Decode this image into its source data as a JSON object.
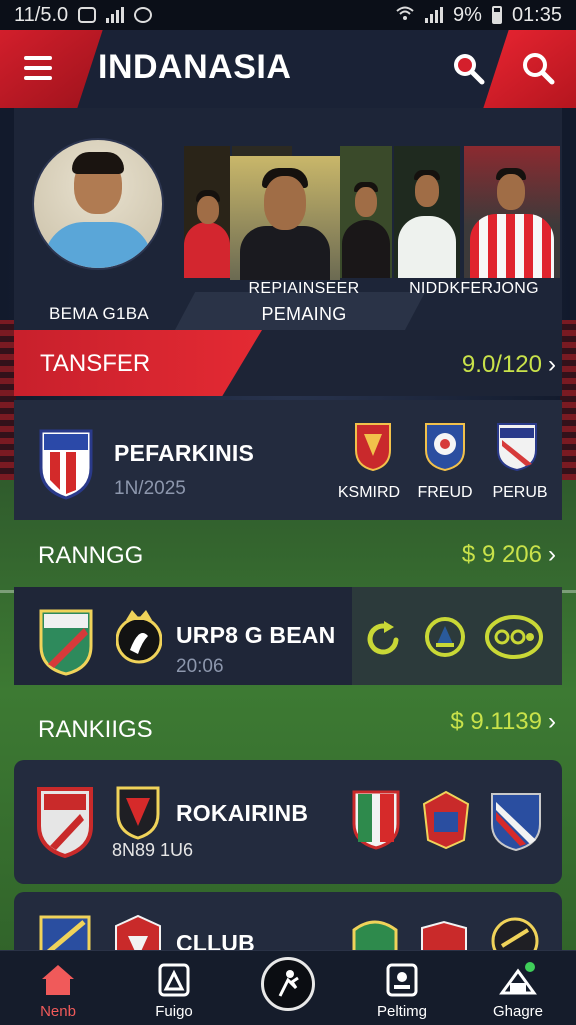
{
  "status_bar": {
    "time_left": "11/5.0",
    "battery_text": "9%",
    "time_right": "01:35"
  },
  "header": {
    "title": "INDANASIA"
  },
  "featured": {
    "name": "BEMA G1BA"
  },
  "players": {
    "caption_center_line1": "REPIAINSEER",
    "caption_center_line2": "PEMAING",
    "caption_right": "NIDDKFERJONG"
  },
  "transfer": {
    "label": "TANSFER",
    "value": "9.0/120",
    "chevron": "›"
  },
  "match1": {
    "name": "PEFARKINIS",
    "date": "1N/2025",
    "clubs": [
      "KSMIRD",
      "FREUD",
      "PERUB"
    ]
  },
  "ranking1": {
    "label": "RANNGG",
    "value": "$ 9 206",
    "chevron": "›"
  },
  "match2": {
    "name": "URP8 G BEAN",
    "date": "20:06"
  },
  "rankings": {
    "label": "RANKIIGS",
    "value": "$ 9.1139",
    "chevron": "›"
  },
  "match3": {
    "name": "ROKAIRINB",
    "sub": "8N89 1U6"
  },
  "match4": {
    "name": "CLLUB"
  },
  "nav": {
    "items": [
      "Nenb",
      "Fuigo",
      "Peltimg",
      "Ghagre"
    ]
  },
  "colors": {
    "accent_red": "#e42a33",
    "accent_lime": "#c9e24a",
    "panel": "#222a3d"
  }
}
